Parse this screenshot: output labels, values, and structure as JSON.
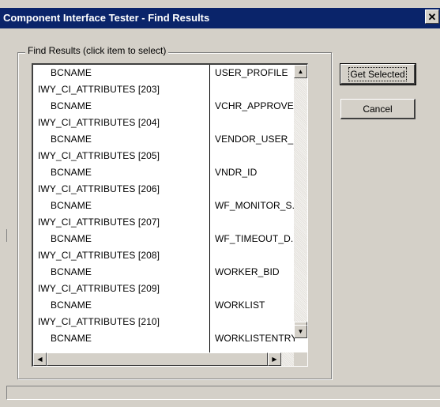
{
  "window": {
    "title": "Component Interface Tester - Find Results",
    "close_glyph": "✕"
  },
  "results_group": {
    "label": "Find Results (click item to select)",
    "rows": [
      {
        "name": "BCNAME",
        "value": "USER_PROFILE"
      },
      {
        "name": "IWY_CI_ATTRIBUTES [203]",
        "value": ""
      },
      {
        "name": "BCNAME",
        "value": "VCHR_APPROVE"
      },
      {
        "name": "IWY_CI_ATTRIBUTES [204]",
        "value": ""
      },
      {
        "name": "BCNAME",
        "value": "VENDOR_USER_"
      },
      {
        "name": "IWY_CI_ATTRIBUTES [205]",
        "value": ""
      },
      {
        "name": "BCNAME",
        "value": "VNDR_ID"
      },
      {
        "name": "IWY_CI_ATTRIBUTES [206]",
        "value": ""
      },
      {
        "name": "BCNAME",
        "value": "WF_MONITOR_S."
      },
      {
        "name": "IWY_CI_ATTRIBUTES [207]",
        "value": ""
      },
      {
        "name": "BCNAME",
        "value": "WF_TIMEOUT_D."
      },
      {
        "name": "IWY_CI_ATTRIBUTES [208]",
        "value": ""
      },
      {
        "name": "BCNAME",
        "value": "WORKER_BID"
      },
      {
        "name": "IWY_CI_ATTRIBUTES [209]",
        "value": ""
      },
      {
        "name": "BCNAME",
        "value": "WORKLIST"
      },
      {
        "name": "IWY_CI_ATTRIBUTES [210]",
        "value": ""
      },
      {
        "name": "BCNAME",
        "value": "WORKLISTENTRY"
      }
    ]
  },
  "scrollbars": {
    "up_arrow": "▲",
    "down_arrow": "▼",
    "left_arrow": "◀",
    "right_arrow": "▶"
  },
  "buttons": {
    "get_selected": "Get Selected",
    "cancel": "Cancel"
  }
}
